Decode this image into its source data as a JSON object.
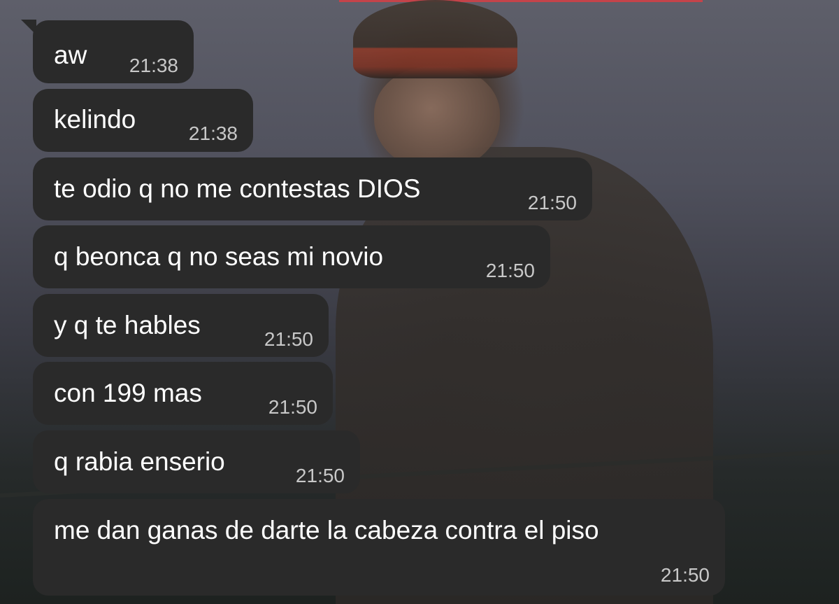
{
  "messages": [
    {
      "text": "aw",
      "time": "21:38"
    },
    {
      "text": "kelindo",
      "time": "21:38"
    },
    {
      "text": "te odio q no me contestas DIOS",
      "time": "21:50"
    },
    {
      "text": "q beonca q no seas mi novio",
      "time": "21:50"
    },
    {
      "text": "y q te hables",
      "time": "21:50"
    },
    {
      "text": "con 199 mas",
      "time": "21:50"
    },
    {
      "text": "q rabia enserio",
      "time": "21:50"
    },
    {
      "text": "me dan ganas de darte la cabeza contra el piso",
      "time": "21:50"
    }
  ],
  "colors": {
    "bubble_background": "#2a2a2a",
    "message_text": "#ffffff",
    "timestamp_text": "#c8c8c8",
    "accent_bar": "#c4434a"
  }
}
